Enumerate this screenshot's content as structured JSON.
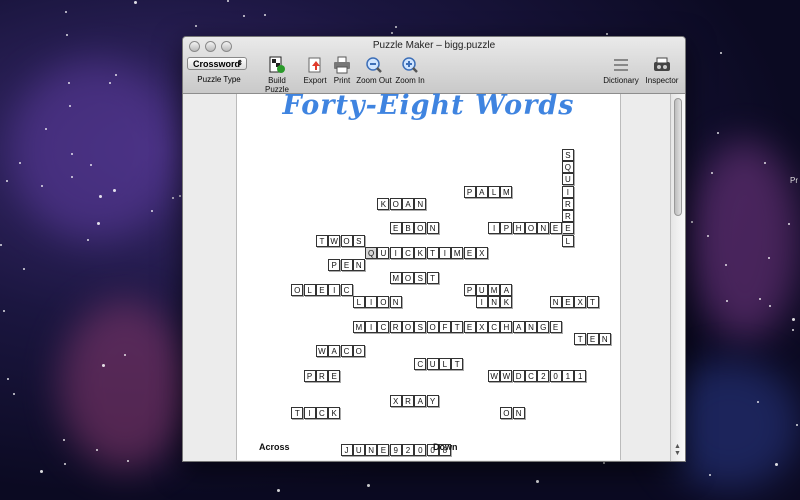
{
  "window": {
    "title": "Puzzle Maker – bigg.puzzle"
  },
  "toolbar": {
    "puzzle_type_value": "Crossword",
    "puzzle_type_label": "Puzzle Type",
    "build_label": "Build Puzzle",
    "export_label": "Export",
    "print_label": "Print",
    "zoom_out_label": "Zoom Out",
    "zoom_in_label": "Zoom In",
    "dictionary_label": "Dictionary",
    "inspector_label": "Inspector"
  },
  "puzzle": {
    "title": "Forty-Eight Words",
    "across_heading": "Across",
    "down_heading": "Down",
    "words": [
      "SQUIRREL",
      "KOAN",
      "PALM",
      "EBON",
      "IPHONE",
      "TWOS",
      "QUICKTIMEX",
      "PEN",
      "MOST",
      "PUMA",
      "OLEIC",
      "LION",
      "INK",
      "NEXT",
      "MICROSOFTEXCHANGE",
      "TEN",
      "WACO",
      "CULT",
      "PRE",
      "WWDC2011",
      "XRAY",
      "TICK",
      "ON",
      "JUNE92008"
    ]
  },
  "desktop": {
    "edge_text": "Pr"
  },
  "colors": {
    "title_blue": "#3f84e0",
    "desktop_bg": "#120f2c"
  },
  "icons": [
    "build-puzzle-icon",
    "export-icon",
    "print-icon",
    "zoom-out-icon",
    "zoom-in-icon",
    "dictionary-icon",
    "inspector-icon"
  ]
}
